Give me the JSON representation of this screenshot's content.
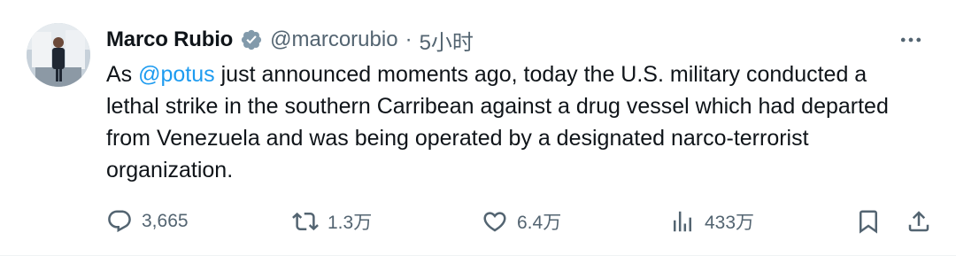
{
  "user": {
    "name": "Marco Rubio",
    "handle": "@marcorubio",
    "separator": "·",
    "time": "5小时"
  },
  "tweet": {
    "prefix": "As ",
    "mention": "@potus",
    "body": " just announced moments ago, today the U.S. military conducted a lethal strike in the southern Carribean against a drug vessel which had departed from Venezuela and was being operated by a designated narco-terrorist organization."
  },
  "stats": {
    "replies": "3,665",
    "reposts": "1.3万",
    "likes": "6.4万",
    "views": "433万"
  },
  "icons": {
    "verified": "verified-badge-icon",
    "more": "more-icon",
    "reply": "reply-icon",
    "repost": "repost-icon",
    "like": "like-icon",
    "views": "views-icon",
    "bookmark": "bookmark-icon",
    "share": "share-icon"
  },
  "colors": {
    "text": "#0f1419",
    "secondary": "#536471",
    "link": "#1d9bf0",
    "verified_badge": "#829aab"
  }
}
